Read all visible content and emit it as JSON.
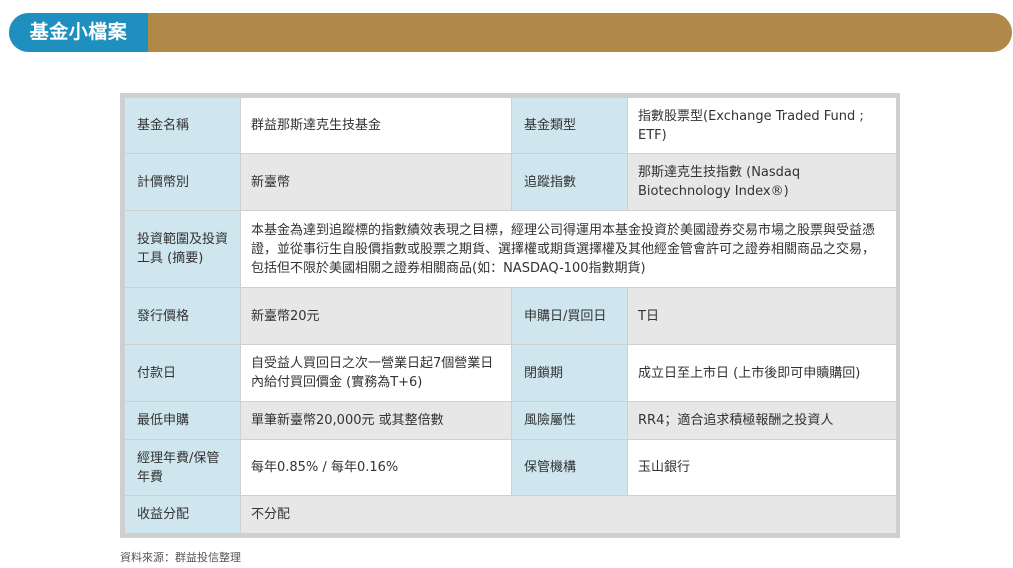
{
  "banner": {
    "title": "基金小檔案"
  },
  "table": {
    "rows": [
      {
        "k1": "基金名稱",
        "v1": "群益那斯達克生技基金",
        "k2": "基金類型",
        "v2": "指數股票型(Exchange Traded Fund ; ETF)"
      },
      {
        "k1": "計價幣別",
        "v1": "新臺幣",
        "k2": "追蹤指數",
        "v2": "那斯達克生技指數 (Nasdaq Biotechnology Index®)"
      },
      {
        "k1": "投資範圍及投資工具 (摘要)",
        "v1": "本基金為達到追蹤標的指數績效表現之目標，經理公司得運用本基金投資於美國證券交易市場之股票與受益憑證，並從事衍生自股價指數或股票之期貨、選擇權或期貨選擇權及其他經金管會許可之證券相關商品之交易，包括但不限於美國相關之證券相關商品(如：NASDAQ-100指數期貨)"
      },
      {
        "k1": "發行價格",
        "v1": "新臺幣20元",
        "k2": "申購日/買回日",
        "v2": "T日"
      },
      {
        "k1": "付款日",
        "v1": "自受益人買回日之次一營業日起7個營業日內給付買回價金 (實務為T+6)",
        "k2": "閉鎖期",
        "v2": "成立日至上市日 (上市後即可申贖購回)"
      },
      {
        "k1": "最低申購",
        "v1": "單筆新臺幣20,000元 或其整倍數",
        "k2": "風險屬性",
        "v2": "RR4；適合追求積極報酬之投資人"
      },
      {
        "k1": "經理年費/保管年費",
        "v1": "每年0.85% / 每年0.16%",
        "k2": "保管機構",
        "v2": "玉山銀行"
      },
      {
        "k1": "收益分配",
        "v1": "不分配"
      }
    ]
  },
  "footer": {
    "source": "資料來源：群益投信整理"
  }
}
